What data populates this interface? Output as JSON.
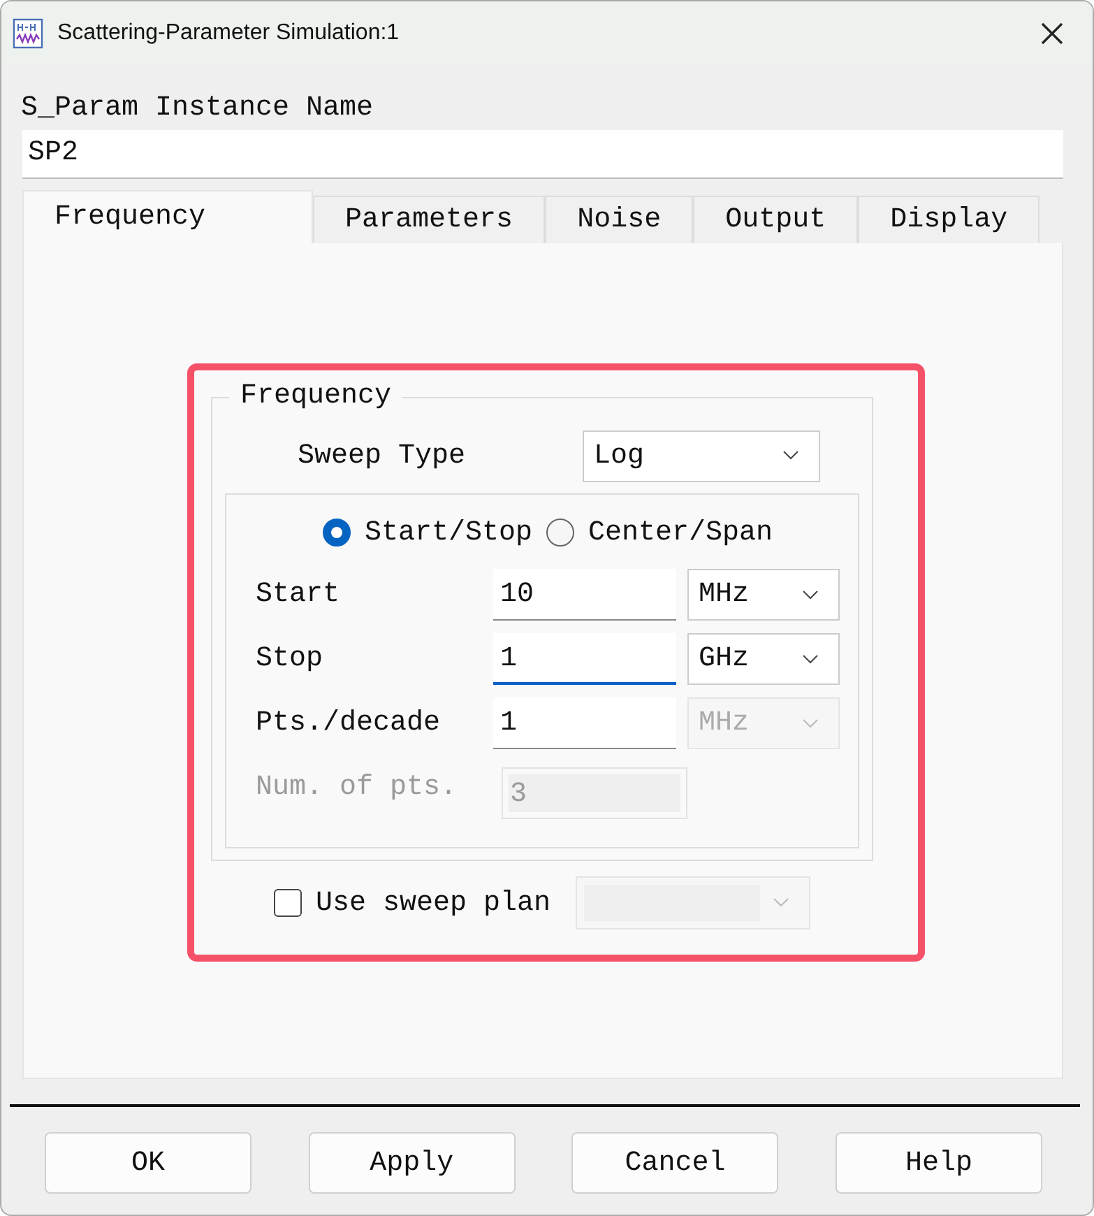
{
  "window": {
    "title": "Scattering-Parameter Simulation:1"
  },
  "instance_name": {
    "label": "S_Param Instance Name",
    "value": "SP2"
  },
  "tabs": [
    {
      "label": "Frequency",
      "selected": true
    },
    {
      "label": "Parameters",
      "selected": false
    },
    {
      "label": "Noise",
      "selected": false
    },
    {
      "label": "Output",
      "selected": false
    },
    {
      "label": "Display",
      "selected": false
    }
  ],
  "frequency_group": {
    "title": "Frequency",
    "sweep_type": {
      "label": "Sweep Type",
      "value": "Log"
    },
    "modes": [
      {
        "label": "Start/Stop",
        "selected": true
      },
      {
        "label": "Center/Span",
        "selected": false
      }
    ],
    "rows": [
      {
        "label": "Start",
        "value": "10",
        "unit": "MHz",
        "disabled": false,
        "focused": false,
        "unit_disabled": false
      },
      {
        "label": "Stop",
        "value": "1",
        "unit": "GHz",
        "disabled": false,
        "focused": true,
        "unit_disabled": false
      },
      {
        "label": "Pts./decade",
        "value": "1",
        "unit": "MHz",
        "disabled": false,
        "focused": false,
        "unit_disabled": true
      },
      {
        "label": "Num. of pts.",
        "value": "3",
        "disabled": true,
        "focused": false
      }
    ]
  },
  "sweep_plan": {
    "label": "Use sweep plan",
    "checked": false,
    "disabled": true
  },
  "buttons": [
    "OK",
    "Apply",
    "Cancel",
    "Help"
  ]
}
